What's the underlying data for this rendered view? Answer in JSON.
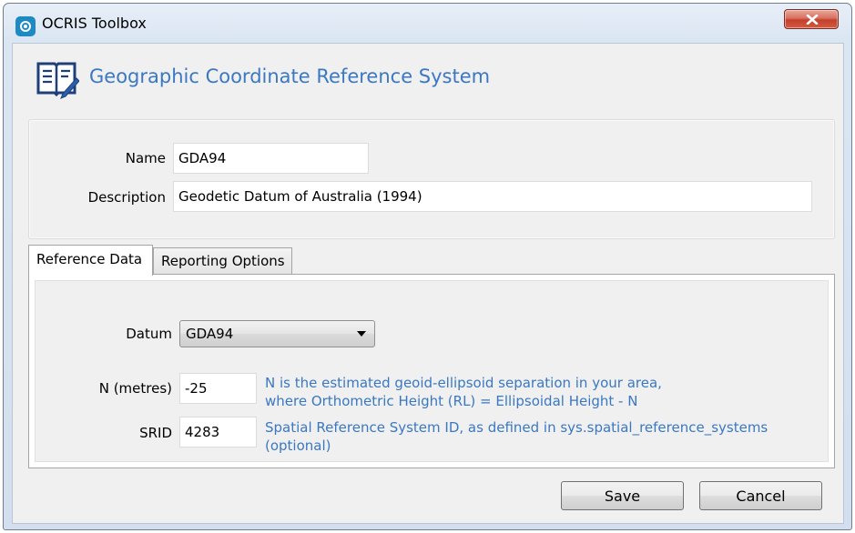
{
  "window": {
    "title": "OCRIS Toolbox",
    "app_icon": "ocris-logo-icon",
    "close_icon": "close-icon"
  },
  "header": {
    "icon": "book-pen-icon",
    "title": "Geographic Coordinate Reference System"
  },
  "general": {
    "name_label": "Name",
    "name_value": "GDA94",
    "description_label": "Description",
    "description_value": "Geodetic Datum of Australia (1994)"
  },
  "tabs": [
    {
      "label": "Reference Data",
      "active": true
    },
    {
      "label": "Reporting Options",
      "active": false
    }
  ],
  "reference_data": {
    "datum_label": "Datum",
    "datum_value": "GDA94",
    "n_label": "N (metres)",
    "n_value": "-25",
    "n_hint_line1": "N is the estimated geoid-ellipsoid separation in your area,",
    "n_hint_line2": "where Orthometric Height (RL) = Ellipsoidal Height - N",
    "srid_label": "SRID",
    "srid_value": "4283",
    "srid_hint_line1": "Spatial Reference System ID, as defined in sys.spatial_reference_systems",
    "srid_hint_line2": "(optional)"
  },
  "actions": {
    "save_label": "Save",
    "cancel_label": "Cancel"
  },
  "colors": {
    "accent_blue": "#3a78c3",
    "close_red": "#c4402c",
    "panel_bg": "#f0f0f0"
  }
}
